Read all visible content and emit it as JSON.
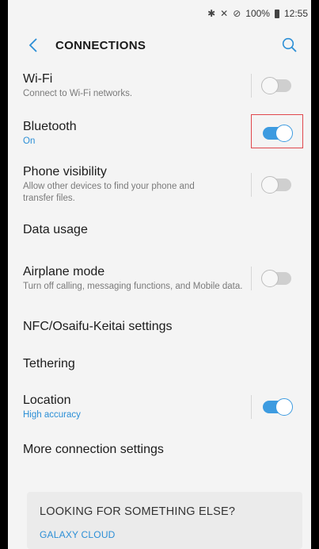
{
  "status_bar": {
    "bluetooth_icon": "bluetooth-icon",
    "signal_icon": "no-signal-icon",
    "dnd_icon": "do-not-disturb-icon",
    "battery": "100%",
    "time": "12:55"
  },
  "app_bar": {
    "title": "CONNECTIONS",
    "back_icon": "back-chevron-icon",
    "search_icon": "search-icon"
  },
  "items": [
    {
      "title": "Wi-Fi",
      "subtitle": "Connect to Wi-Fi networks.",
      "toggle": false
    },
    {
      "title": "Bluetooth",
      "subtitle": "On",
      "toggle": true
    },
    {
      "title": "Phone visibility",
      "subtitle": "Allow other devices to find your phone and transfer files.",
      "toggle": false
    },
    {
      "title": "Data usage"
    },
    {
      "title": "Airplane mode",
      "subtitle": "Turn off calling, messaging functions, and Mobile data.",
      "toggle": false
    },
    {
      "title": "NFC/Osaifu-Keitai settings"
    },
    {
      "title": "Tethering"
    },
    {
      "title": "Location",
      "subtitle": "High accuracy",
      "toggle": true
    },
    {
      "title": "More connection settings"
    }
  ],
  "card": {
    "title": "LOOKING FOR SOMETHING ELSE?",
    "link": "GALAXY CLOUD"
  },
  "colors": {
    "accent": "#3d9be0",
    "highlight": "#e0474c"
  }
}
